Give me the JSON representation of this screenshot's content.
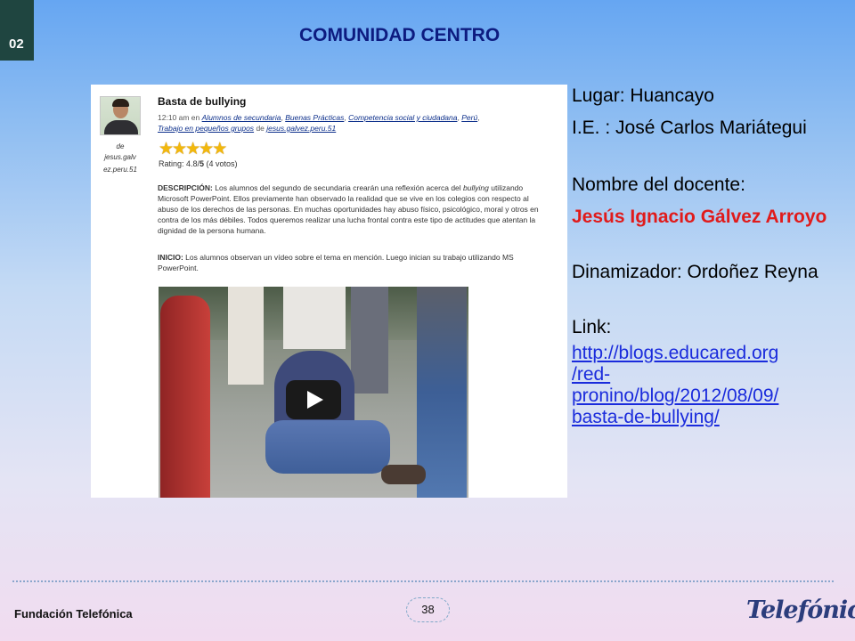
{
  "slide": {
    "number": "02",
    "title": "COMUNIDAD CENTRO"
  },
  "blog_card": {
    "title": "Basta de bullying",
    "meta_time": "12:10 am en",
    "meta_categories": [
      "Alumnos de secundaria",
      "Buenas Prácticas",
      "Competencia social y ciudadana",
      "Perú",
      "Trabajo en pequeños grupos"
    ],
    "meta_de": "de",
    "meta_author": "jesus.galvez.peru.51",
    "author_prefix": "de",
    "author_name": "jesus.galv ez.peru.51",
    "stars_filled": 5,
    "rating_prefix": "Rating: 4.8/",
    "rating_bold": "5",
    "rating_suffix": " (4 votos)",
    "desc_label": "DESCRIPCIÓN:",
    "desc_text_1": " Los alumnos del segundo de secundaria crearán una reflexión acerca del ",
    "desc_italic": "bullying",
    "desc_text_2": " utilizando Microsoft PowerPoint. Ellos previamente han observado la realidad que se vive en los colegios con respecto al abuso de los derechos de las personas. En muchas oportunidades hay abuso físico, psicológico, moral y otros en contra de los más débiles. Todos queremos realizar una lucha frontal contra este tipo de actitudes que atentan la dignidad de la persona humana.",
    "inicio_label": "INICIO:",
    "inicio_text": " Los alumnos observan un vídeo sobre el tema en mención. Luego inician su trabajo utilizando MS PowerPoint."
  },
  "info": {
    "lugar": "Lugar: Huancayo",
    "ie": "I.E. : José Carlos Mariátegui",
    "docente_label": "Nombre del docente:",
    "docente_name": "Jesús Ignacio Gálvez Arroyo",
    "dinamizador": "Dinamizador: Ordoñez Reyna",
    "link_label": "Link:",
    "link_url": "http://blogs.educared.org/red-pronino/blog/2012/08/09/basta-de-bullying/",
    "link_line1": "http://blogs.educared.org",
    "link_line2": "/red-",
    "link_line3": "pronino/blog/2012/08/09/",
    "link_line4": "basta-de-bullying/"
  },
  "footer": {
    "organization": "Fundación Telefónica",
    "page_number": "38",
    "logo_text": "Telefónica"
  },
  "colors": {
    "title": "#0d1b80",
    "highlight_name": "#e01b1b",
    "link": "#1a2bdc",
    "slide_tab": "#1f4540"
  }
}
